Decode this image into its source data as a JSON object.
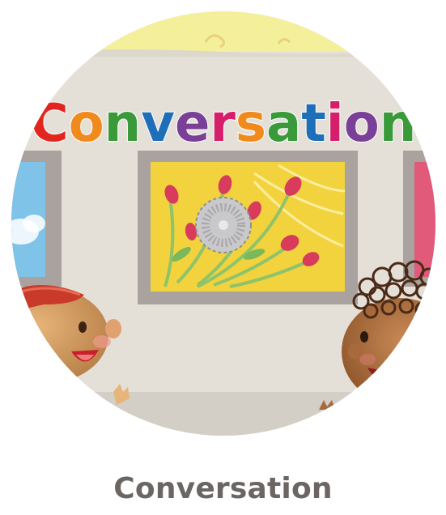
{
  "lesson": {
    "banner_text": "Conversation",
    "caption": "Conversation"
  },
  "colors": {
    "wall": "#e4e0d8",
    "ceiling": "#f3ef9a",
    "frame": "#a9a29e",
    "painting_center_bg": "#f2d33e",
    "painting_left_bg": "#7fc4e8",
    "painting_right_bg": "#e25a7a",
    "caption_text": "#6b6664",
    "banner_letters": [
      "#e2261f",
      "#f08a1c",
      "#3a9a3a",
      "#1f6fb8",
      "#7a3f96",
      "#d61f6b",
      "#f08a1c",
      "#3a9a3a",
      "#1f6fb8",
      "#d61f6b",
      "#7a3f96",
      "#3a9a3a"
    ]
  }
}
